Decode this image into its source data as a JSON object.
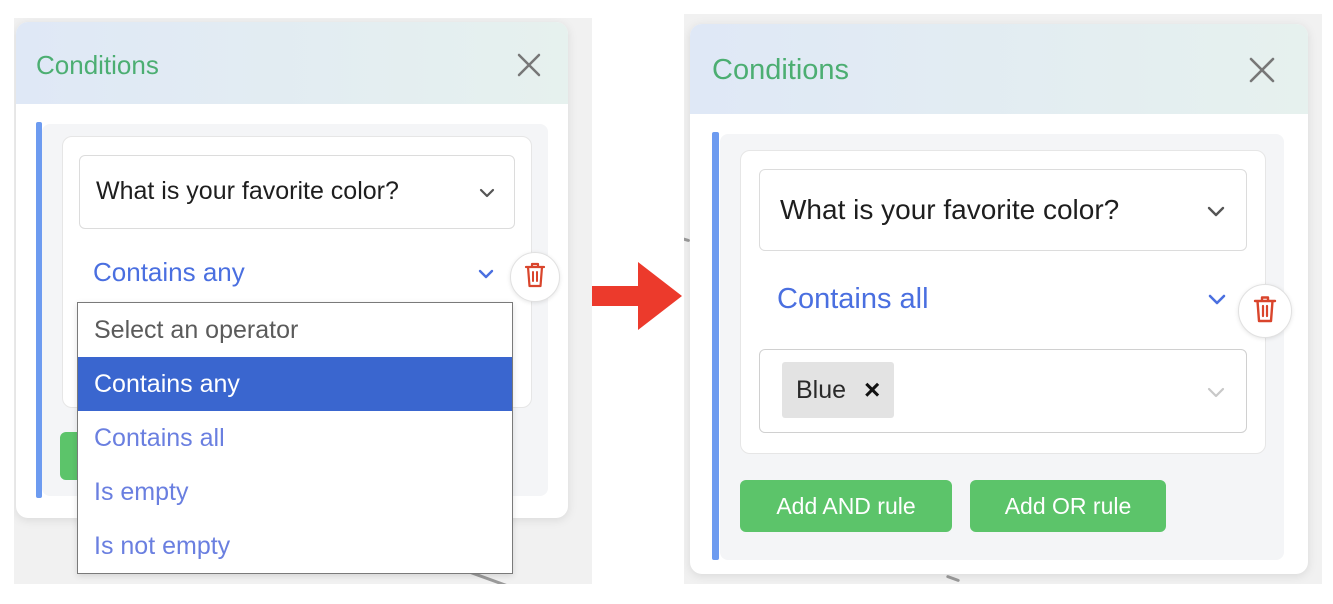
{
  "before": {
    "dialog": {
      "title": "Conditions",
      "question_value": "What is your favorite color?",
      "operator_value": "Contains any"
    },
    "operator_dropdown": {
      "options": [
        {
          "label": "Select an operator",
          "state": "placeholder"
        },
        {
          "label": "Contains any",
          "state": "selected"
        },
        {
          "label": "Contains all",
          "state": "normal"
        },
        {
          "label": "Is empty",
          "state": "normal"
        },
        {
          "label": "Is not empty",
          "state": "normal"
        }
      ]
    }
  },
  "after": {
    "dialog": {
      "title": "Conditions",
      "question_value": "What is your favorite color?",
      "operator_value": "Contains all",
      "selected_tags": [
        {
          "label": "Blue",
          "remove_icon": "×"
        }
      ],
      "add_and_label": "Add AND rule",
      "add_or_label": "Add OR rule"
    }
  },
  "icons": {
    "close": "close-icon",
    "chevron": "chevron-down-icon",
    "trash": "trash-icon",
    "arrow": "arrow-right-icon"
  },
  "colors": {
    "title_green": "#4cae72",
    "operator_blue": "#4a6fe0",
    "selected_option_bg": "#3a66cf",
    "rule_bar_blue": "#6d9bf0",
    "button_green": "#5cc46a",
    "trash_red": "#d9452c",
    "arrow_red": "#ec3a2c"
  }
}
